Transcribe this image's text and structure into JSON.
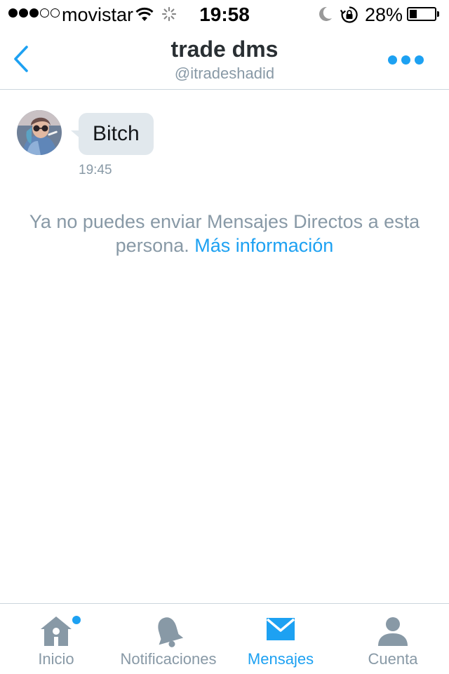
{
  "status_bar": {
    "carrier": "movistar",
    "time": "19:58",
    "battery_percent": "28%",
    "battery_level": 0.28,
    "signal_bars_filled": 3,
    "signal_bars_total": 5
  },
  "header": {
    "title": "trade dms",
    "subtitle": "@itradeshadid",
    "back_icon": "chevron-left-icon",
    "more_icon": "more-dots-icon"
  },
  "conversation": {
    "message": {
      "text": "Bitch",
      "time": "19:45"
    },
    "notice_text": "Ya no puedes enviar Mensajes Directos a esta persona.",
    "notice_link": "Más información"
  },
  "tab_bar": {
    "tabs": [
      {
        "label": "Inicio",
        "icon": "home-icon",
        "active": false,
        "has_dot": true
      },
      {
        "label": "Notificaciones",
        "icon": "bell-icon",
        "active": false
      },
      {
        "label": "Mensajes",
        "icon": "envelope-icon",
        "active": true
      },
      {
        "label": "Cuenta",
        "icon": "person-icon",
        "active": false
      }
    ]
  },
  "colors": {
    "accent": "#1da1f2",
    "muted_text": "#8899a6",
    "bubble": "#e1e8ed",
    "inactive_icon": "#8899a6"
  }
}
